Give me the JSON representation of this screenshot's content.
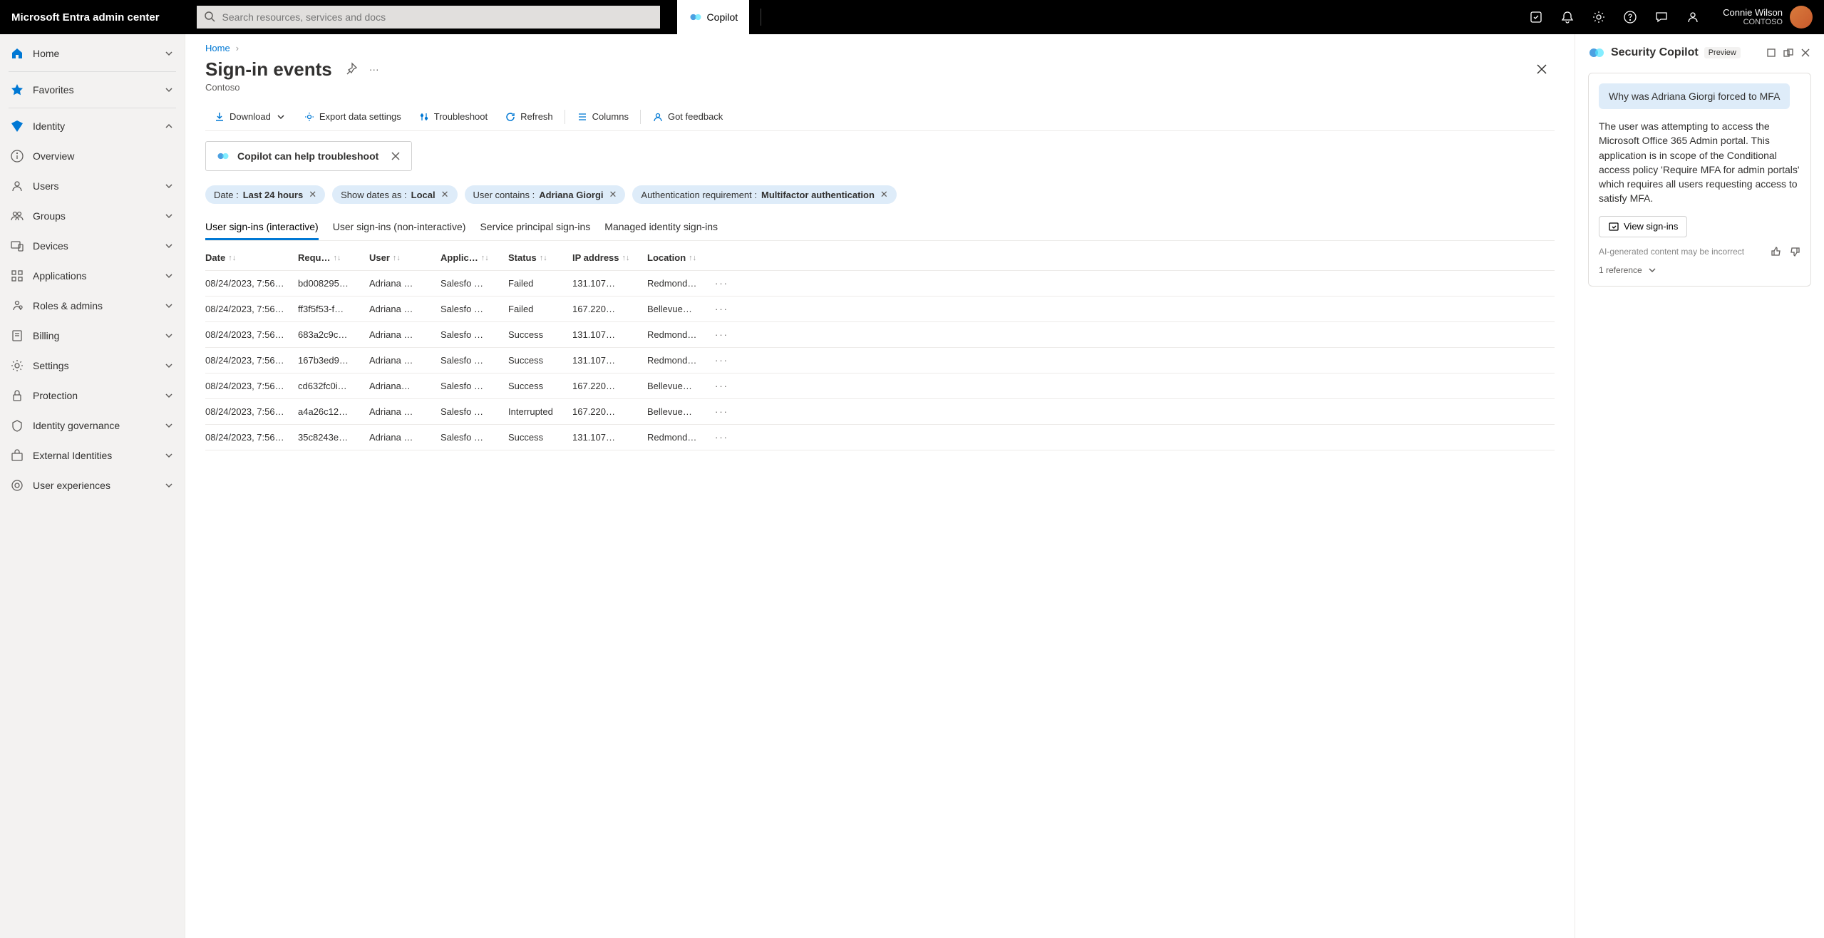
{
  "brand": "Microsoft Entra admin center",
  "search": {
    "placeholder": "Search resources, services and docs"
  },
  "copilot_btn": "Copilot",
  "user": {
    "name": "Connie Wilson",
    "org": "CONTOSO"
  },
  "sidebar": {
    "home": "Home",
    "favorites": "Favorites",
    "identity": "Identity",
    "items": {
      "overview": "Overview",
      "users": "Users",
      "groups": "Groups",
      "devices": "Devices",
      "applications": "Applications",
      "roles": "Roles & admins",
      "billing": "Billing",
      "settings": "Settings",
      "protection": "Protection",
      "governance": "Identity governance",
      "external": "External Identities",
      "userexp": "User experiences"
    }
  },
  "breadcrumb": {
    "home": "Home"
  },
  "page": {
    "title": "Sign-in events",
    "subtitle": "Contoso"
  },
  "toolbar": {
    "download": "Download",
    "export": "Export data settings",
    "troubleshoot": "Troubleshoot",
    "refresh": "Refresh",
    "columns": "Columns",
    "feedback": "Got feedback"
  },
  "banner": {
    "text": "Copilot can help troubleshoot"
  },
  "filters": {
    "date_k": "Date : ",
    "date_v": "Last 24 hours",
    "tz_k": "Show dates as : ",
    "tz_v": "Local",
    "user_k": "User contains : ",
    "user_v": "Adriana Giorgi",
    "auth_k": "Authentication requirement : ",
    "auth_v": "Multifactor authentication"
  },
  "tabs": {
    "t1": "User sign-ins (interactive)",
    "t2": "User sign-ins (non-interactive)",
    "t3": "Service principal sign-ins",
    "t4": "Managed identity sign-ins"
  },
  "cols": {
    "date": "Date",
    "req": "Requ…",
    "user": "User",
    "app": "Applic…",
    "status": "Status",
    "ip": "IP address",
    "loc": "Location"
  },
  "rows": [
    {
      "date": "08/24/2023, 7:56…",
      "req": "bd008295…",
      "user": "Adriana …",
      "app": "Salesfo …",
      "status": "Failed",
      "ip": "131.107…",
      "loc": "Redmond…"
    },
    {
      "date": "08/24/2023, 7:56…",
      "req": "ff3f5f53-f…",
      "user": "Adriana …",
      "app": "Salesfo …",
      "status": "Failed",
      "ip": "167.220…",
      "loc": "Bellevue…"
    },
    {
      "date": "08/24/2023, 7:56…",
      "req": "683a2c9c…",
      "user": "Adriana …",
      "app": "Salesfo …",
      "status": "Success",
      "ip": "131.107…",
      "loc": "Redmond…"
    },
    {
      "date": "08/24/2023, 7:56…",
      "req": "167b3ed9…",
      "user": "Adriana …",
      "app": "Salesfo …",
      "status": "Success",
      "ip": "131.107…",
      "loc": "Redmond…"
    },
    {
      "date": "08/24/2023, 7:56…",
      "req": "cd632fc0i…",
      "user": "Adriana…",
      "app": "Salesfo …",
      "status": "Success",
      "ip": "167.220…",
      "loc": "Bellevue…"
    },
    {
      "date": "08/24/2023, 7:56…",
      "req": "a4a26c12…",
      "user": "Adriana …",
      "app": "Salesfo …",
      "status": "Interrupted",
      "ip": "167.220…",
      "loc": "Bellevue…"
    },
    {
      "date": "08/24/2023, 7:56…",
      "req": "35c8243e…",
      "user": "Adriana …",
      "app": "Salesfo …",
      "status": "Success",
      "ip": "131.107…",
      "loc": "Redmond…"
    }
  ],
  "panel": {
    "title": "Security Copilot",
    "badge": "Preview",
    "prompt": "Why was Adriana Giorgi forced to MFA",
    "answer": "The user was attempting to access the Microsoft Office 365 Admin portal. This application is in scope of the Conditional access policy 'Require MFA for admin portals' which requires all users requesting access to satisfy MFA.",
    "view": "View sign-ins",
    "ai_note": "AI-generated content may be incorrect",
    "ref": "1 reference"
  }
}
